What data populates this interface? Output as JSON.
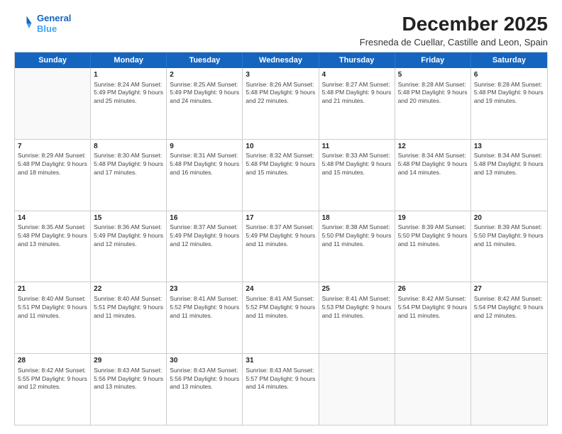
{
  "header": {
    "logo_line1": "General",
    "logo_line2": "Blue",
    "month_title": "December 2025",
    "location": "Fresneda de Cuellar, Castille and Leon, Spain"
  },
  "days_of_week": [
    "Sunday",
    "Monday",
    "Tuesday",
    "Wednesday",
    "Thursday",
    "Friday",
    "Saturday"
  ],
  "weeks": [
    [
      {
        "day": "",
        "info": ""
      },
      {
        "day": "1",
        "info": "Sunrise: 8:24 AM\nSunset: 5:49 PM\nDaylight: 9 hours\nand 25 minutes."
      },
      {
        "day": "2",
        "info": "Sunrise: 8:25 AM\nSunset: 5:49 PM\nDaylight: 9 hours\nand 24 minutes."
      },
      {
        "day": "3",
        "info": "Sunrise: 8:26 AM\nSunset: 5:48 PM\nDaylight: 9 hours\nand 22 minutes."
      },
      {
        "day": "4",
        "info": "Sunrise: 8:27 AM\nSunset: 5:48 PM\nDaylight: 9 hours\nand 21 minutes."
      },
      {
        "day": "5",
        "info": "Sunrise: 8:28 AM\nSunset: 5:48 PM\nDaylight: 9 hours\nand 20 minutes."
      },
      {
        "day": "6",
        "info": "Sunrise: 8:28 AM\nSunset: 5:48 PM\nDaylight: 9 hours\nand 19 minutes."
      }
    ],
    [
      {
        "day": "7",
        "info": "Sunrise: 8:29 AM\nSunset: 5:48 PM\nDaylight: 9 hours\nand 18 minutes."
      },
      {
        "day": "8",
        "info": "Sunrise: 8:30 AM\nSunset: 5:48 PM\nDaylight: 9 hours\nand 17 minutes."
      },
      {
        "day": "9",
        "info": "Sunrise: 8:31 AM\nSunset: 5:48 PM\nDaylight: 9 hours\nand 16 minutes."
      },
      {
        "day": "10",
        "info": "Sunrise: 8:32 AM\nSunset: 5:48 PM\nDaylight: 9 hours\nand 15 minutes."
      },
      {
        "day": "11",
        "info": "Sunrise: 8:33 AM\nSunset: 5:48 PM\nDaylight: 9 hours\nand 15 minutes."
      },
      {
        "day": "12",
        "info": "Sunrise: 8:34 AM\nSunset: 5:48 PM\nDaylight: 9 hours\nand 14 minutes."
      },
      {
        "day": "13",
        "info": "Sunrise: 8:34 AM\nSunset: 5:48 PM\nDaylight: 9 hours\nand 13 minutes."
      }
    ],
    [
      {
        "day": "14",
        "info": "Sunrise: 8:35 AM\nSunset: 5:48 PM\nDaylight: 9 hours\nand 13 minutes."
      },
      {
        "day": "15",
        "info": "Sunrise: 8:36 AM\nSunset: 5:49 PM\nDaylight: 9 hours\nand 12 minutes."
      },
      {
        "day": "16",
        "info": "Sunrise: 8:37 AM\nSunset: 5:49 PM\nDaylight: 9 hours\nand 12 minutes."
      },
      {
        "day": "17",
        "info": "Sunrise: 8:37 AM\nSunset: 5:49 PM\nDaylight: 9 hours\nand 11 minutes."
      },
      {
        "day": "18",
        "info": "Sunrise: 8:38 AM\nSunset: 5:50 PM\nDaylight: 9 hours\nand 11 minutes."
      },
      {
        "day": "19",
        "info": "Sunrise: 8:39 AM\nSunset: 5:50 PM\nDaylight: 9 hours\nand 11 minutes."
      },
      {
        "day": "20",
        "info": "Sunrise: 8:39 AM\nSunset: 5:50 PM\nDaylight: 9 hours\nand 11 minutes."
      }
    ],
    [
      {
        "day": "21",
        "info": "Sunrise: 8:40 AM\nSunset: 5:51 PM\nDaylight: 9 hours\nand 11 minutes."
      },
      {
        "day": "22",
        "info": "Sunrise: 8:40 AM\nSunset: 5:51 PM\nDaylight: 9 hours\nand 11 minutes."
      },
      {
        "day": "23",
        "info": "Sunrise: 8:41 AM\nSunset: 5:52 PM\nDaylight: 9 hours\nand 11 minutes."
      },
      {
        "day": "24",
        "info": "Sunrise: 8:41 AM\nSunset: 5:52 PM\nDaylight: 9 hours\nand 11 minutes."
      },
      {
        "day": "25",
        "info": "Sunrise: 8:41 AM\nSunset: 5:53 PM\nDaylight: 9 hours\nand 11 minutes."
      },
      {
        "day": "26",
        "info": "Sunrise: 8:42 AM\nSunset: 5:54 PM\nDaylight: 9 hours\nand 11 minutes."
      },
      {
        "day": "27",
        "info": "Sunrise: 8:42 AM\nSunset: 5:54 PM\nDaylight: 9 hours\nand 12 minutes."
      }
    ],
    [
      {
        "day": "28",
        "info": "Sunrise: 8:42 AM\nSunset: 5:55 PM\nDaylight: 9 hours\nand 12 minutes."
      },
      {
        "day": "29",
        "info": "Sunrise: 8:43 AM\nSunset: 5:56 PM\nDaylight: 9 hours\nand 13 minutes."
      },
      {
        "day": "30",
        "info": "Sunrise: 8:43 AM\nSunset: 5:56 PM\nDaylight: 9 hours\nand 13 minutes."
      },
      {
        "day": "31",
        "info": "Sunrise: 8:43 AM\nSunset: 5:57 PM\nDaylight: 9 hours\nand 14 minutes."
      },
      {
        "day": "",
        "info": ""
      },
      {
        "day": "",
        "info": ""
      },
      {
        "day": "",
        "info": ""
      }
    ]
  ]
}
